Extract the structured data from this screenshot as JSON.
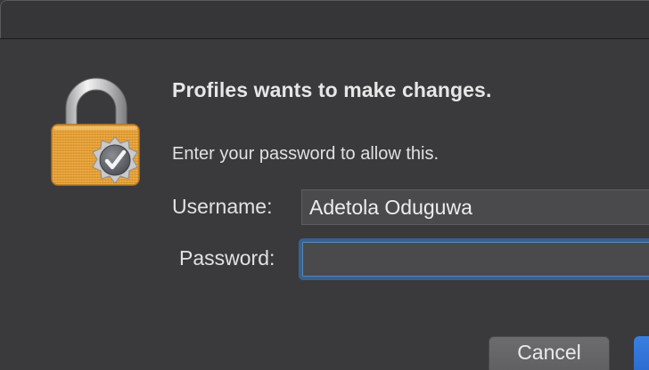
{
  "dialog": {
    "title": "Profiles wants to make changes.",
    "message": "Enter your password to allow this.",
    "username_label": "Username:",
    "username_value": "Adetola Oduguwa",
    "password_label": "Password:",
    "password_value": "",
    "cancel_label": "Cancel",
    "default_button_label": ""
  },
  "colors": {
    "background": "#3a3a3c",
    "focus_ring": "#36628f",
    "default_button": "#2f72d8",
    "lock_body": "#e9a23b"
  },
  "icons": {
    "lock": "padlock-with-verified-checkmark-badge"
  }
}
